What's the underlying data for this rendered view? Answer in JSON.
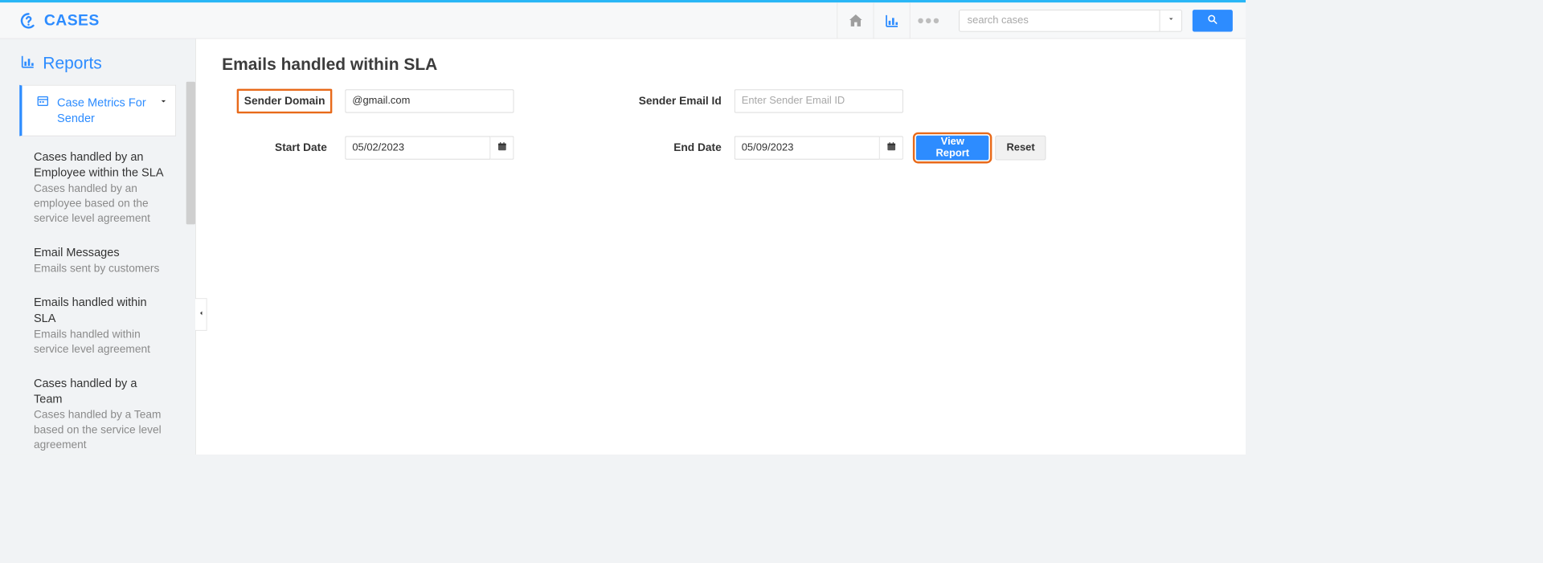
{
  "brand": {
    "title": "CASES"
  },
  "header": {
    "search_placeholder": "search cases"
  },
  "sidebar": {
    "title": "Reports",
    "active": {
      "label": "Case Metrics For Sender"
    },
    "items": [
      {
        "title": "Cases handled by an Employee within the SLA",
        "desc": "Cases handled by an employee based on the service level agreement"
      },
      {
        "title": "Email Messages",
        "desc": "Emails sent by customers"
      },
      {
        "title": "Emails handled within SLA",
        "desc": "Emails handled within service level agreement"
      },
      {
        "title": "Cases handled by a Team",
        "desc": "Cases handled by a Team based on the service level agreement"
      }
    ]
  },
  "main": {
    "title": "Emails handled within SLA",
    "labels": {
      "sender_domain": "Sender Domain",
      "sender_email": "Sender Email Id",
      "start_date": "Start Date",
      "end_date": "End Date"
    },
    "values": {
      "sender_domain": "@gmail.com",
      "sender_email_placeholder": "Enter Sender Email ID",
      "start_date": "05/02/2023",
      "end_date": "05/09/2023"
    },
    "buttons": {
      "view_report": "View Report",
      "reset": "Reset"
    }
  }
}
